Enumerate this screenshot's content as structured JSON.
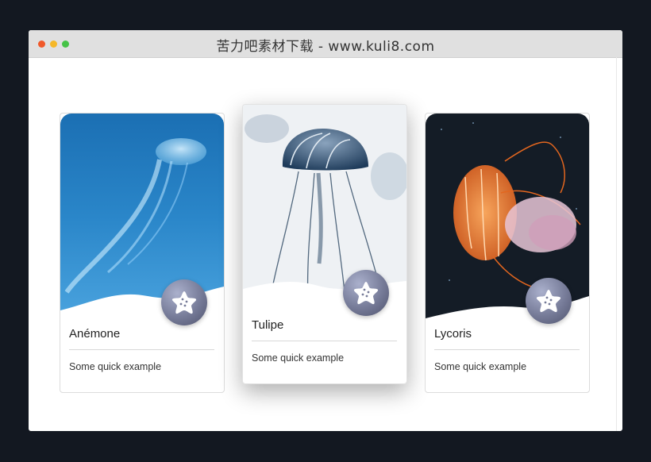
{
  "window": {
    "title": "苦力吧素材下载 - www.kuli8.com"
  },
  "cards": [
    {
      "name": "Anémone",
      "description": "Some quick example",
      "badge_icon": "starfish-icon"
    },
    {
      "name": "Tulipe",
      "description": "Some quick example",
      "badge_icon": "starfish-icon"
    },
    {
      "name": "Lycoris",
      "description": "Some quick example",
      "badge_icon": "starfish-icon"
    }
  ],
  "colors": {
    "page_background": "#131821",
    "badge": "#767b98",
    "traffic_red": "#f0592a",
    "traffic_yellow": "#f5b829",
    "traffic_green": "#46c347"
  }
}
